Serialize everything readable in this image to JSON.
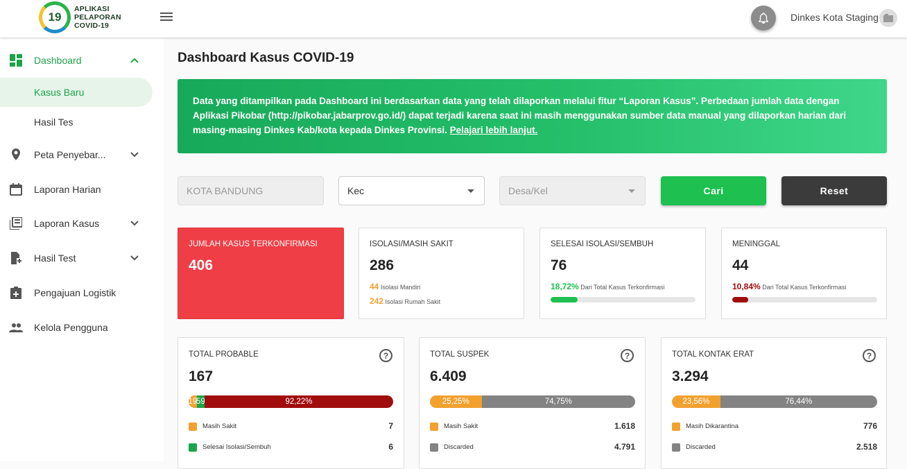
{
  "header": {
    "logo_number": "19",
    "logo_line1": "APLIKASI",
    "logo_line2": "PELAPORAN",
    "logo_line3": "COVID-19",
    "user_name": "Dinkes Kota Staging"
  },
  "sidebar": {
    "dashboard": "Dashboard",
    "kasus_baru": "Kasus Baru",
    "hasil_tes": "Hasil Tes",
    "peta": "Peta Penyebar...",
    "laporan_harian": "Laporan Harian",
    "laporan_kasus": "Laporan Kasus",
    "hasil_test": "Hasil Test",
    "pengajuan_logistik": "Pengajuan Logistik",
    "kelola_pengguna": "Kelola Pengguna"
  },
  "page": {
    "title": "Dashboard Kasus COVID-19",
    "notice_text": "Data yang ditampilkan pada Dashboard ini berdasarkan data yang telah dilaporkan melalui fitur “Laporan Kasus”. Perbedaan jumlah data dengan Aplikasi Pikobar (http://pikobar.jabarprov.go.id/) dapat terjadi karena saat ini masih menggunakan sumber data manual yang dilaporkan harian dari masing-masing Dinkes Kab/kota kepada Dinkes Provinsi.",
    "notice_link": "Pelajari lebih lanjut."
  },
  "filters": {
    "kota_value": "KOTA BANDUNG",
    "kec_value": "Kec",
    "desa_placeholder": "Desa/Kel",
    "search_label": "Cari",
    "reset_label": "Reset"
  },
  "colors": {
    "green": "#1ec04f",
    "red": "#ef3e45",
    "orange": "#f2a12f",
    "dark_red": "#a10d0d",
    "gray": "#838383",
    "dark_green": "#18a54c"
  },
  "stats": {
    "confirmed": {
      "title": "JUMLAH KASUS TERKONFIRMASI",
      "value": "406"
    },
    "isolation": {
      "title": "ISOLASI/MASIH SAKIT",
      "value": "286",
      "mandiri_value": "44",
      "mandiri_label": "Isolasi Mandiri",
      "rs_value": "242",
      "rs_label": "Isolasi Rumah Sakit"
    },
    "recovered": {
      "title": "SELESAI ISOLASI/SEMBUH",
      "value": "76",
      "pct": "18,72%",
      "pct_label": "Dari Total Kasus Terkonfirmasi",
      "fraction": 0.1872
    },
    "deaths": {
      "title": "MENINGGAL",
      "value": "44",
      "pct": "10,84%",
      "pct_label": "Dari Total Kasus Terkonfirmasi",
      "fraction": 0.1084
    }
  },
  "probable": {
    "title": "TOTAL PROBABLE",
    "value": "167",
    "segments": [
      {
        "label": "4,19%",
        "fraction": 0.0419,
        "color": "#f2a12f"
      },
      {
        "label": "3,59%",
        "fraction": 0.0359,
        "color": "#18a54c"
      },
      {
        "label": "92,22%",
        "fraction": 0.9222,
        "color": "#a10d0d"
      }
    ],
    "legend": [
      {
        "label": "Masih Sakit",
        "value": "7",
        "color": "#f2a12f"
      },
      {
        "label": "Selesai Isolasi/Sembuh",
        "value": "6",
        "color": "#18a54c"
      }
    ]
  },
  "suspek": {
    "title": "TOTAL SUSPEK",
    "value": "6.409",
    "segments": [
      {
        "label": "25,25%",
        "fraction": 0.2525,
        "color": "#f2a12f"
      },
      {
        "label": "74,75%",
        "fraction": 0.7475,
        "color": "#838383"
      }
    ],
    "legend": [
      {
        "label": "Masih Sakit",
        "value": "1.618",
        "color": "#f2a12f"
      },
      {
        "label": "Discarded",
        "value": "4.791",
        "color": "#838383"
      }
    ]
  },
  "kontak": {
    "title": "TOTAL KONTAK ERAT",
    "value": "3.294",
    "segments": [
      {
        "label": "23,56%",
        "fraction": 0.2356,
        "color": "#f2a12f"
      },
      {
        "label": "76,44%",
        "fraction": 0.7644,
        "color": "#838383"
      }
    ],
    "legend": [
      {
        "label": "Masih Dikarantina",
        "value": "776",
        "color": "#f2a12f"
      },
      {
        "label": "Discarded",
        "value": "2.518",
        "color": "#838383"
      }
    ]
  }
}
